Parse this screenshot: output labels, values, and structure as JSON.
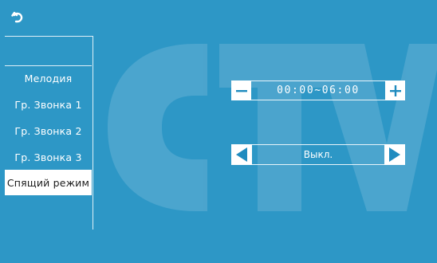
{
  "header": {
    "back_icon": "return-arrow-icon"
  },
  "menu": {
    "items": [
      {
        "label": "Мелодия"
      },
      {
        "label": "Гр. Звонка 1"
      },
      {
        "label": "Гр. Звонка 2"
      },
      {
        "label": "Гр. Звонка 3"
      },
      {
        "label": "Спящий режим"
      }
    ],
    "selected_index": 4
  },
  "time_range": {
    "value": "00:00~06:00",
    "decrease_icon": "minus-icon",
    "increase_icon": "plus-icon"
  },
  "mode_selector": {
    "value": "Выкл.",
    "prev_icon": "triangle-left-icon",
    "next_icon": "triangle-right-icon"
  },
  "colors": {
    "background": "#2d97c6",
    "watermark": "#56a9d0",
    "selected_bg": "#ffffff",
    "button_icon": "#1f8bbf"
  }
}
